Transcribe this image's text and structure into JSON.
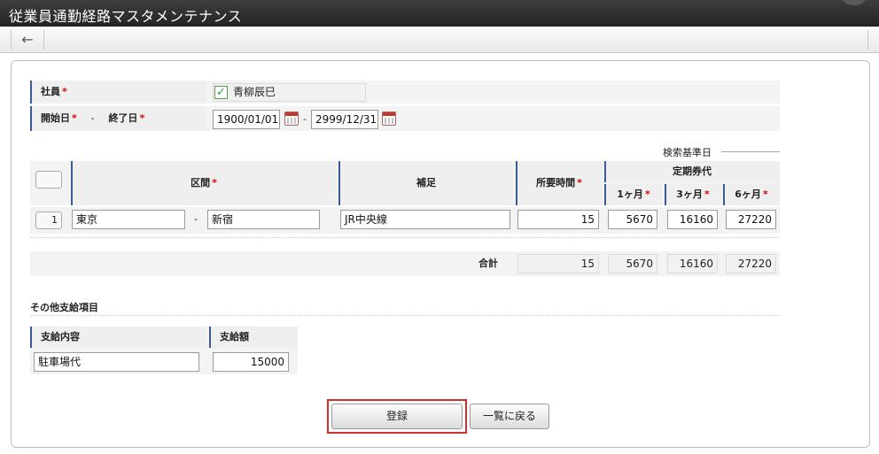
{
  "window": {
    "title": "従業員通勤経路マスタメンテナンス"
  },
  "toolbar": {
    "back_icon": "←"
  },
  "form": {
    "employee": {
      "label": "社員",
      "value": "青柳辰巳"
    },
    "period": {
      "start_label": "開始日",
      "separator": "-",
      "end_label": "終了日",
      "start_value": "1900/01/01",
      "range_sep": "-",
      "end_value": "2999/12/31"
    },
    "required_mark": "*"
  },
  "route_table": {
    "search_base_label": "検索基準日",
    "headers": {
      "section": "区間",
      "note": "補足",
      "time": "所要時間",
      "pass_group": "定期券代",
      "m1": "1ヶ月",
      "m3": "3ヶ月",
      "m6": "6ヶ月"
    },
    "rows": [
      {
        "no": "1",
        "from": "東京",
        "dash": "-",
        "to": "新宿",
        "note": "JR中央線",
        "time": "15",
        "m1": "5670",
        "m3": "16160",
        "m6": "27220"
      }
    ],
    "total": {
      "label": "合計",
      "time": "15",
      "m1": "5670",
      "m3": "16160",
      "m6": "27220"
    }
  },
  "other": {
    "section_title": "その他支給項目",
    "headers": {
      "content": "支給内容",
      "amount": "支給額"
    },
    "rows": [
      {
        "content": "駐車場代",
        "amount": "15000"
      }
    ]
  },
  "actions": {
    "register": "登録",
    "back_to_list": "一覧に戻る"
  }
}
